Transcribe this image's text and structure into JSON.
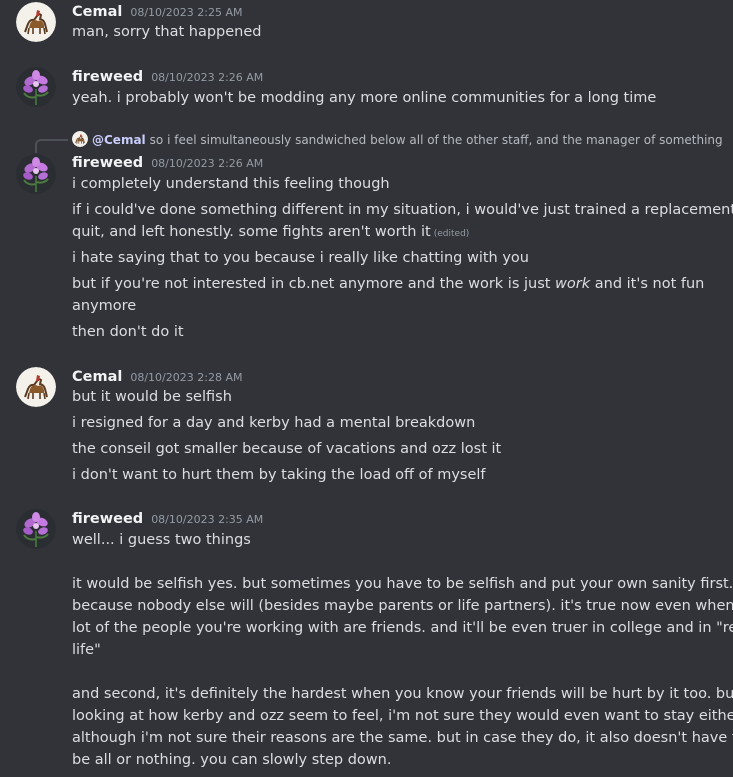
{
  "messages": [
    {
      "author": "Cemal",
      "timestamp": "08/10/2023 2:25 AM",
      "avatar_icon": "camel-avatar-icon",
      "lines": [
        "man, sorry that happened"
      ]
    },
    {
      "author": "fireweed",
      "timestamp": "08/10/2023 2:26 AM",
      "avatar_icon": "flower-avatar-icon",
      "lines": [
        "yeah. i probably won't be modding any more online communities for a long time"
      ]
    },
    {
      "author": "fireweed",
      "timestamp": "08/10/2023 2:26 AM",
      "avatar_icon": "flower-avatar-icon",
      "reply": {
        "mention": "@Cemal",
        "preview": "so i feel simultaneously sandwiched below all of the other staff, and the manager of something"
      },
      "lines": [
        "i completely understand this feeling though",
        "if i could've done something different in my situation, i would've just trained a replacement,",
        "quit, and left honestly. some fights aren't worth it",
        "i hate saying that to you because i really like chatting with you",
        "but if you're not interested in cb.net anymore and the work is just ",
        "anymore",
        "then don't do it"
      ],
      "edited_label": "(edited)",
      "emphasis_word": "work",
      "line5_tail": " and it's not fun"
    },
    {
      "author": "Cemal",
      "timestamp": "08/10/2023 2:28 AM",
      "avatar_icon": "camel-avatar-icon",
      "lines": [
        "but it would be selfish",
        "i resigned for a day and kerby had a mental breakdown",
        "the conseil got smaller because of vacations and ozz lost it",
        "i don't want to hurt them by taking the load off of myself"
      ]
    },
    {
      "author": "fireweed",
      "timestamp": "08/10/2023 2:35 AM",
      "avatar_icon": "flower-avatar-icon",
      "lines": [
        "well... i guess two things",
        "it would be selfish yes. but sometimes you have to be selfish and put your own sanity first.",
        "because nobody else will (besides maybe parents or life partners). it's true now even when a",
        "lot of the people you're working with are friends. and it'll be even truer in college and in \"real",
        "life\"",
        "and second, it's definitely the hardest when you know your friends will be hurt by it too. but...",
        "looking at how kerby and ozz seem to feel, i'm not sure they would even want to stay either,",
        "although i'm not sure their reasons are the same. but in case they do, it also doesn't have to",
        "be all or nothing. you can slowly step down."
      ]
    }
  ]
}
